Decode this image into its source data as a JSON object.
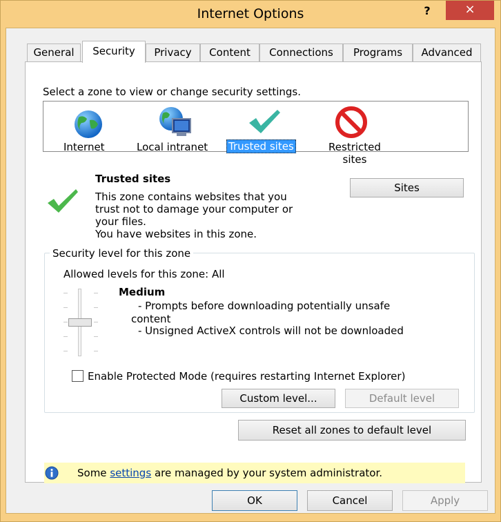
{
  "window": {
    "title": "Internet Options",
    "help": "?",
    "close": "×"
  },
  "tabs": [
    {
      "label": "General"
    },
    {
      "label": "Security"
    },
    {
      "label": "Privacy"
    },
    {
      "label": "Content"
    },
    {
      "label": "Connections"
    },
    {
      "label": "Programs"
    },
    {
      "label": "Advanced"
    }
  ],
  "security": {
    "zone_prompt": "Select a zone to view or change security settings.",
    "zones": [
      {
        "label": "Internet",
        "icon": "globe-icon"
      },
      {
        "label": "Local intranet",
        "icon": "globe-monitor-icon"
      },
      {
        "label": "Trusted sites",
        "icon": "checkmark-icon"
      },
      {
        "label_line1": "Restricted",
        "label_line2": "sites",
        "icon": "no-entry-icon"
      }
    ],
    "selected_zone": {
      "title": "Trusted sites",
      "desc_lines": [
        "This zone contains websites that you",
        "trust not to damage your computer or",
        "your files.",
        "You have websites in this zone."
      ]
    },
    "sites_button": "Sites",
    "level_group_label": "Security level for this zone",
    "allowed_levels": "Allowed levels for this zone: All",
    "level_name": "Medium",
    "level_details": [
      "- Prompts before downloading potentially unsafe",
      "content",
      "- Unsigned ActiveX controls will not be downloaded"
    ],
    "protected_mode_label": "Enable Protected Mode (requires restarting Internet Explorer)",
    "protected_mode_checked": false,
    "custom_level_button": "Custom level...",
    "default_level_button": "Default level",
    "reset_button": "Reset all zones to default level",
    "info_prefix": "Some",
    "info_link": "settings",
    "info_suffix": "are managed by your system administrator."
  },
  "footer": {
    "ok": "OK",
    "cancel": "Cancel",
    "apply": "Apply"
  },
  "colors": {
    "selection": "#3399ff",
    "close_button": "#c7453c",
    "frame": "#f8cf84",
    "info_bar": "#fffbbe"
  }
}
